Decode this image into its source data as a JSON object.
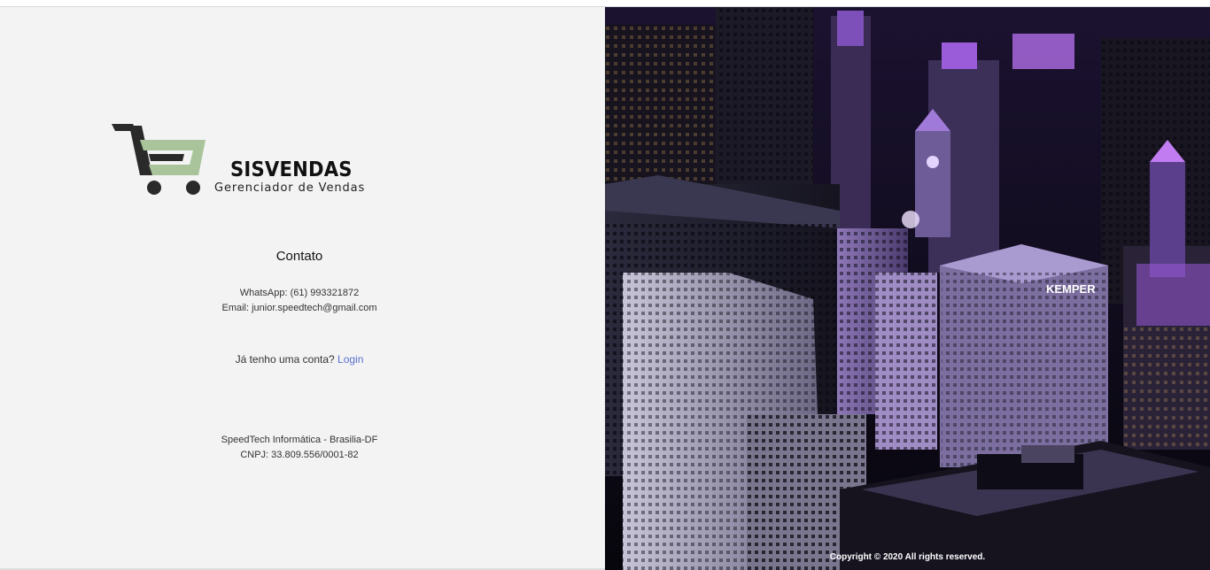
{
  "brand": {
    "name": "SISVENDAS",
    "tagline": "Gerenciador de Vendas",
    "cart_color": "#a9c49b",
    "cart_dark": "#2a2a2a"
  },
  "contact": {
    "heading": "Contato",
    "whatsapp": "WhatsApp: (61) 993321872",
    "email": "Email: junior.speedtech@gmail.com"
  },
  "login": {
    "prompt": "Já tenho uma conta?",
    "link_label": "Login",
    "link_color": "#5a6fd0"
  },
  "company": {
    "name": "SpeedTech Informática - Brasilia-DF",
    "cnpj": "CNPJ: 33.809.556/0001-82"
  },
  "hero": {
    "sign_text": "KEMPER",
    "copyright": "Copyright © 2020 All rights reserved.",
    "accent_color": "#b066e6"
  }
}
